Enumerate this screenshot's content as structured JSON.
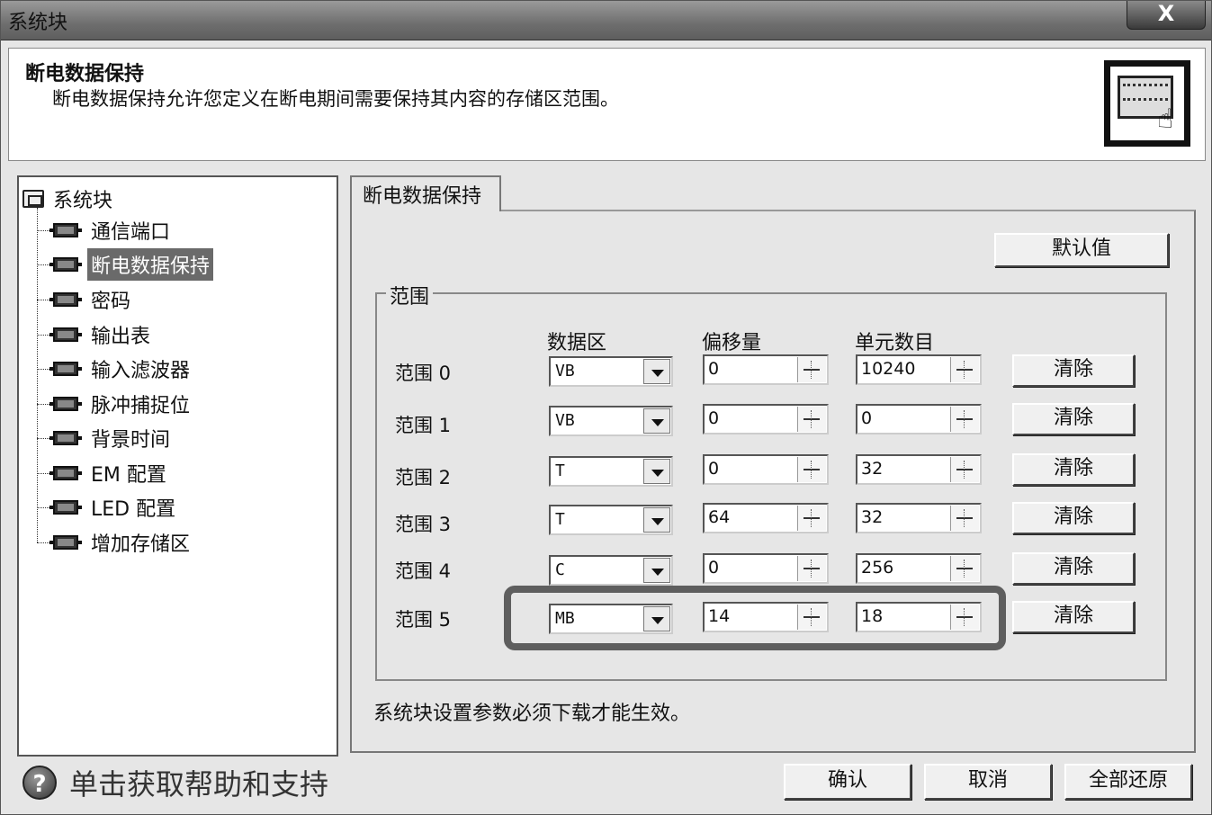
{
  "window": {
    "title": "系统块",
    "close_label": "X"
  },
  "header": {
    "title": "断电数据保持",
    "description": "断电数据保持允许您定义在断电期间需要保持其内容的存储区范围。",
    "icon": "system-block-icon"
  },
  "tree": {
    "root": "系统块",
    "items": [
      {
        "label": "通信端口",
        "selected": false
      },
      {
        "label": "断电数据保持",
        "selected": true
      },
      {
        "label": "密码",
        "selected": false
      },
      {
        "label": "输出表",
        "selected": false
      },
      {
        "label": "输入滤波器",
        "selected": false
      },
      {
        "label": "脉冲捕捉位",
        "selected": false
      },
      {
        "label": "背景时间",
        "selected": false
      },
      {
        "label": "EM 配置",
        "selected": false
      },
      {
        "label": "LED 配置",
        "selected": false
      },
      {
        "label": "增加存储区",
        "selected": false
      }
    ]
  },
  "tab": {
    "label": "断电数据保持"
  },
  "default_button": "默认值",
  "group": {
    "label": "范围",
    "columns": {
      "area": "数据区",
      "offset": "偏移量",
      "count": "单元数目"
    },
    "rows": [
      {
        "label": "范围 0",
        "area": "VB",
        "offset": "0",
        "count": "10240",
        "clear": "清除"
      },
      {
        "label": "范围 1",
        "area": "VB",
        "offset": "0",
        "count": "0",
        "clear": "清除"
      },
      {
        "label": "范围 2",
        "area": "T",
        "offset": "0",
        "count": "32",
        "clear": "清除"
      },
      {
        "label": "范围 3",
        "area": "T",
        "offset": "64",
        "count": "32",
        "clear": "清除"
      },
      {
        "label": "范围 4",
        "area": "C",
        "offset": "0",
        "count": "256",
        "clear": "清除"
      },
      {
        "label": "范围 5",
        "area": "MB",
        "offset": "14",
        "count": "18",
        "clear": "清除"
      }
    ]
  },
  "note": "系统块设置参数必须下载才能生效。",
  "help": {
    "label": "单击获取帮助和支持",
    "icon": "question-icon"
  },
  "footer": {
    "ok": "确认",
    "cancel": "取消",
    "restore_all": "全部还原"
  }
}
